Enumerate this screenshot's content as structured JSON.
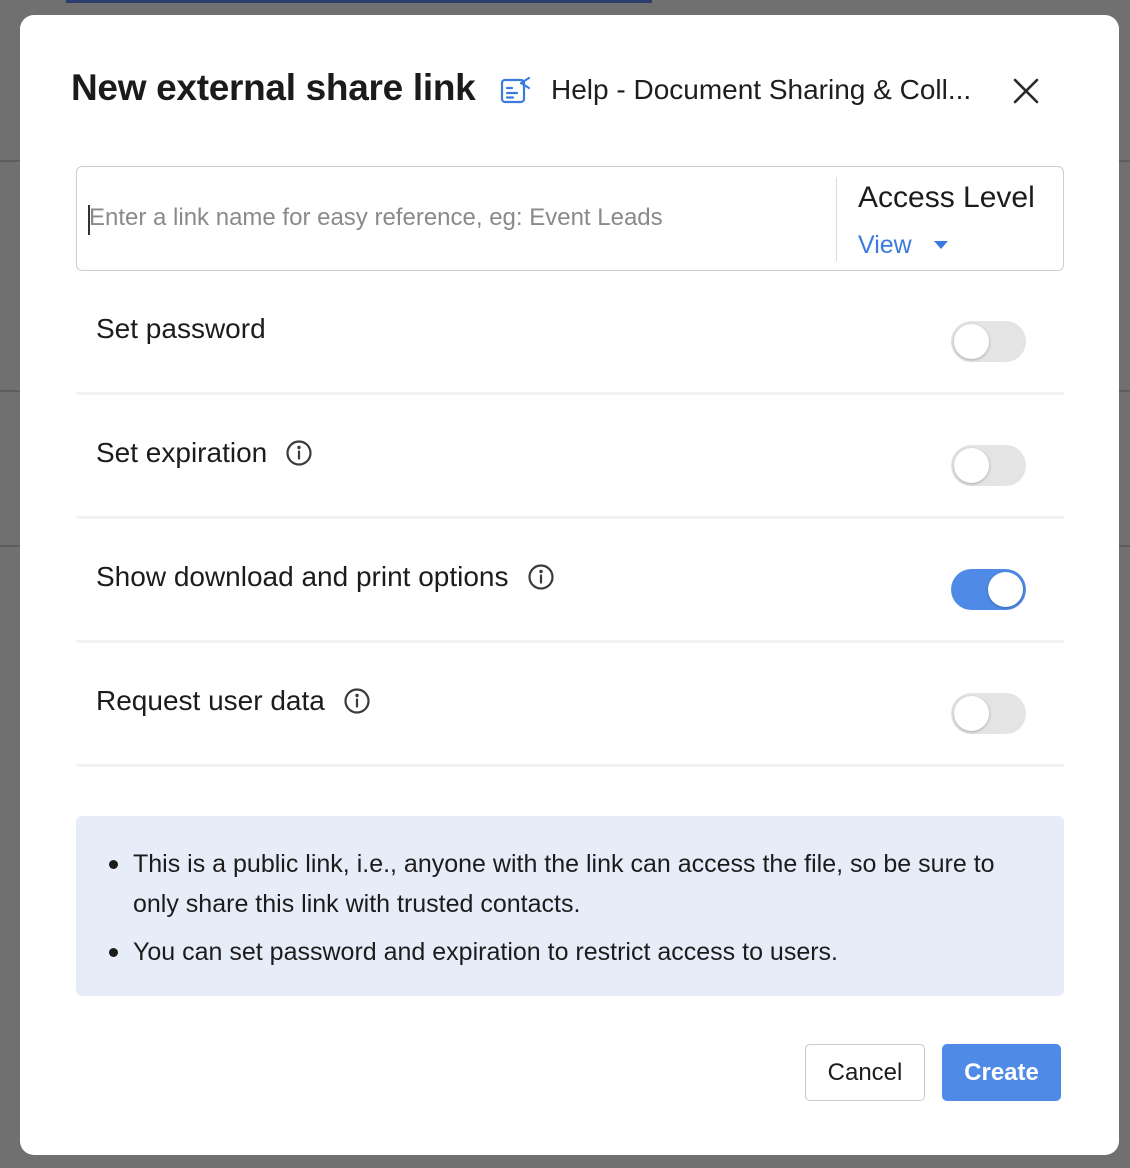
{
  "dialog": {
    "title": "New external share link",
    "document_icon": "document-share-icon",
    "document_name": "Help - Document Sharing & Coll...",
    "close_icon": "close-icon"
  },
  "link_name": {
    "placeholder": "Enter a link name for easy reference, eg: Event Leads",
    "value": ""
  },
  "access_level": {
    "label": "Access Level",
    "selected": "View",
    "dropdown_icon": "caret-down-icon",
    "accent_color": "#3b7be0"
  },
  "options": [
    {
      "label": "Set password",
      "has_info": false,
      "enabled": false
    },
    {
      "label": "Set expiration",
      "has_info": true,
      "enabled": false
    },
    {
      "label": "Show download and print options",
      "has_info": true,
      "enabled": true
    },
    {
      "label": "Request user data",
      "has_info": true,
      "enabled": false
    }
  ],
  "info_icon": "info-circle-icon",
  "note": {
    "items": [
      "This is a public link, i.e., anyone with the link can access the file, so be sure to only share this link with trusted contacts.",
      "You can set password and expiration to restrict access to users."
    ],
    "background": "#e6ecf8"
  },
  "footer": {
    "cancel_label": "Cancel",
    "create_label": "Create",
    "primary_color": "#4f8be6"
  }
}
